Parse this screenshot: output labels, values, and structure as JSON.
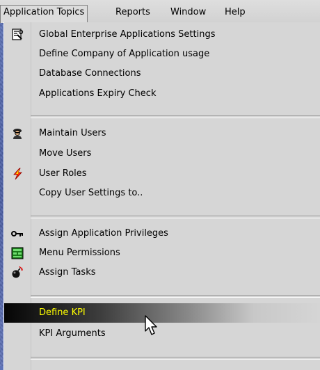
{
  "menubar": {
    "items": [
      {
        "label": "Application Topics",
        "active": true
      },
      {
        "label": "Reports"
      },
      {
        "label": "Window"
      },
      {
        "label": "Help"
      }
    ]
  },
  "menu": {
    "groups": [
      {
        "items": [
          {
            "label": "Global Enterprise Applications Settings",
            "icon": "settings-doc-icon"
          },
          {
            "label": "Define Company of Application usage",
            "icon": ""
          },
          {
            "label": "Database Connections",
            "icon": ""
          },
          {
            "label": "Applications Expiry Check",
            "icon": ""
          }
        ]
      },
      {
        "items": [
          {
            "label": "Maintain Users",
            "icon": "user-icon"
          },
          {
            "label": "Move Users",
            "icon": ""
          },
          {
            "label": "User Roles",
            "icon": "lightning-icon"
          },
          {
            "label": "Copy User Settings to..",
            "icon": ""
          }
        ]
      },
      {
        "items": [
          {
            "label": "Assign Application Privileges",
            "icon": "key-icon"
          },
          {
            "label": "Menu Permissions",
            "icon": "grid-icon"
          },
          {
            "label": "Assign Tasks",
            "icon": "bomb-icon"
          }
        ]
      },
      {
        "items": [
          {
            "label": "Define KPI",
            "icon": "",
            "highlighted": true
          },
          {
            "label": "KPI Arguments",
            "icon": ""
          }
        ]
      }
    ]
  },
  "colors": {
    "highlight_text": "#ffff00",
    "menu_bg": "#d6d6d6"
  }
}
